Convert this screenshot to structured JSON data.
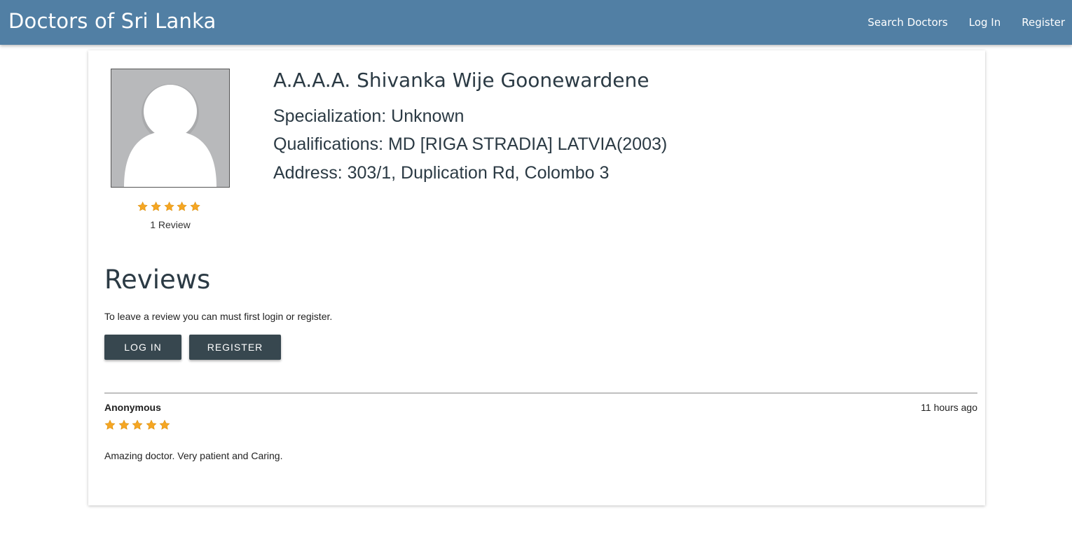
{
  "navbar": {
    "brand": "Doctors of Sri Lanka",
    "links": [
      "Search Doctors",
      "Log In",
      "Register"
    ]
  },
  "doctor": {
    "name": "A.A.A.A. Shivanka Wije Goonewardene",
    "specialization": "Specialization: Unknown",
    "qualifications": "Qualifications: MD [RIGA STRADIA] LATVIA(2003)",
    "address": "Address: 303/1, Duplication Rd, Colombo 3",
    "rating": 5,
    "rating_max": 5,
    "review_count": "1 Review"
  },
  "reviews_section": {
    "title": "Reviews",
    "note": "To leave a review you can must first login or register.",
    "login_button": "LOG IN",
    "register_button": "REGISTER",
    "items": [
      {
        "author": "Anonymous",
        "time": "11 hours ago",
        "rating": 5,
        "text": "Amazing doctor. Very patient and Caring."
      }
    ]
  },
  "colors": {
    "navbar": "#517fa4",
    "button": "#37474f",
    "star": "#f5a623",
    "avatar_bg": "#b8b9bb"
  },
  "icons": [
    "star-icon",
    "avatar-placeholder-icon"
  ]
}
